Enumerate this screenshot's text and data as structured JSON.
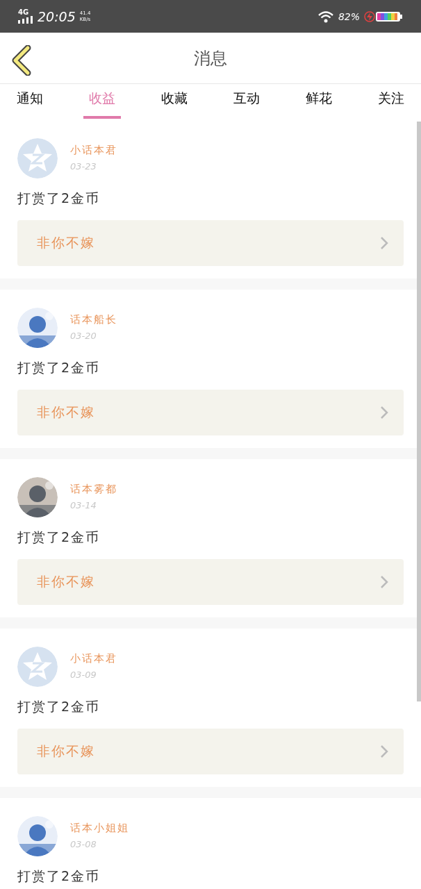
{
  "status_bar": {
    "network": "4G",
    "time": "20:05",
    "speed_value": "41.4",
    "speed_unit": "KB/s",
    "battery": "82%"
  },
  "header": {
    "title": "消息"
  },
  "tabs": [
    {
      "label": "通知",
      "selected": false
    },
    {
      "label": "收益",
      "selected": true
    },
    {
      "label": "收藏",
      "selected": false
    },
    {
      "label": "互动",
      "selected": false
    },
    {
      "label": "鲜花",
      "selected": false
    },
    {
      "label": "关注",
      "selected": false
    }
  ],
  "messages": [
    {
      "avatar": {
        "kind": "default"
      },
      "name": "小话本君",
      "date": "03-23",
      "text": "打赏了2金币",
      "book": "非你不嫁"
    },
    {
      "name": "话本船长",
      "date": "03-20",
      "text": "打赏了2金币",
      "book": "非你不嫁"
    },
    {
      "name": "话本雾都",
      "date": "03-14",
      "text": "打赏了2金币",
      "book": "非你不嫁"
    },
    {
      "avatar": {
        "kind": "default"
      },
      "name": "小话本君",
      "date": "03-09",
      "text": "打赏了2金币",
      "book": "非你不嫁"
    },
    {
      "name": "话本小姐姐",
      "date": "03-08",
      "text": "打赏了2金币"
    }
  ]
}
